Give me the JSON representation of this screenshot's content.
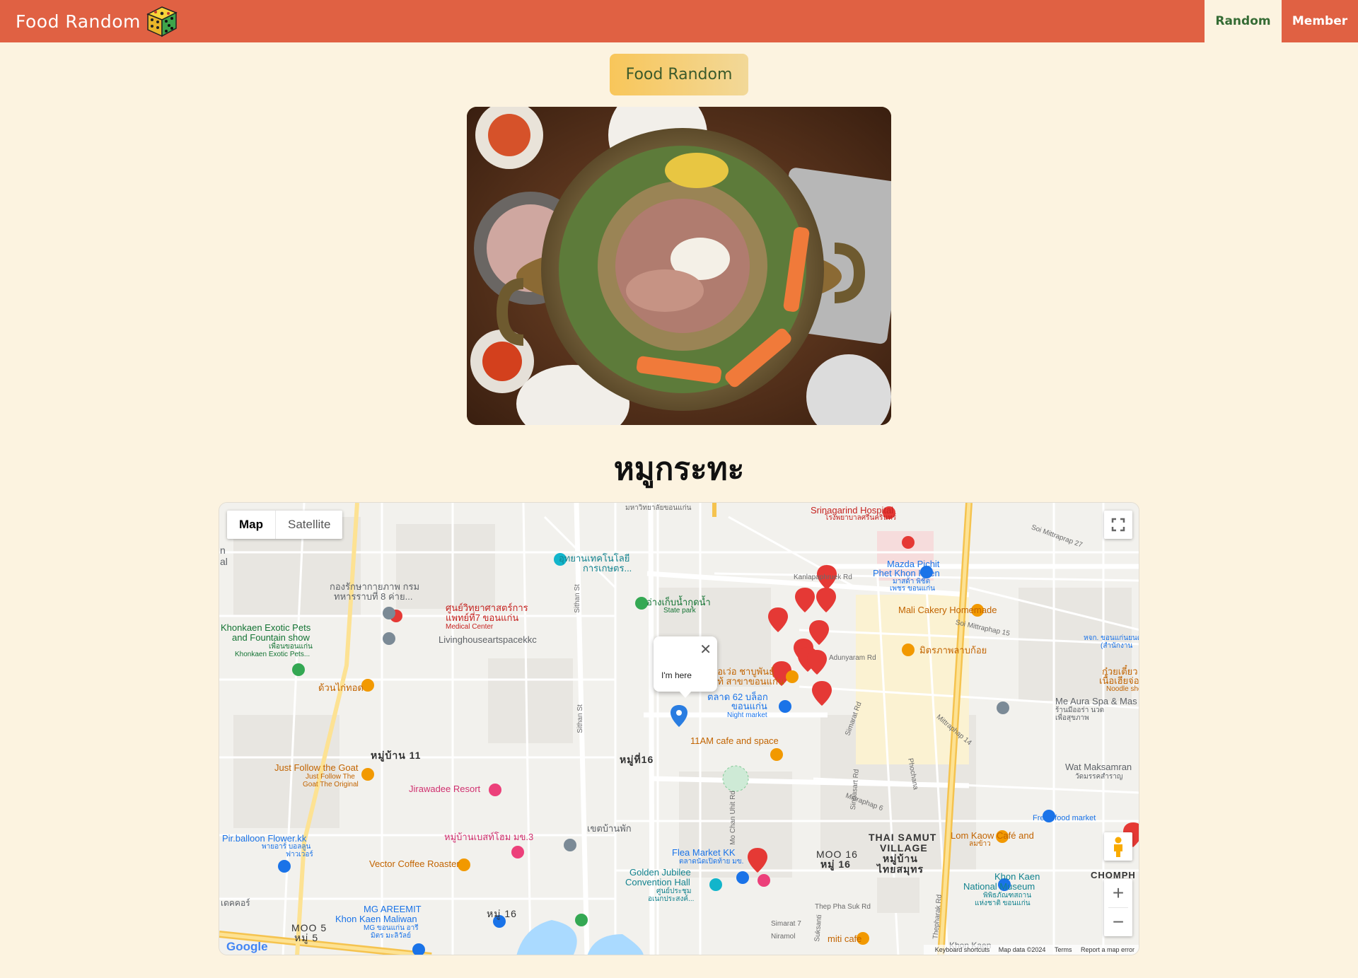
{
  "header": {
    "brand": "Food Random",
    "nav": {
      "random": "Random",
      "member": "Member"
    },
    "colors": {
      "bar": "#e06143",
      "active_bg": "#fcf3e0",
      "active_text": "#356b34"
    }
  },
  "random_button": {
    "label": "Food Random"
  },
  "food": {
    "name": "หมูกระทะ",
    "image_icon": "food-photo-icon"
  },
  "map": {
    "type_control": {
      "map": "Map",
      "satellite": "Satellite",
      "selected": "Map"
    },
    "info_window": {
      "text": "I'm here"
    },
    "zoom": {
      "in": "+",
      "out": "−"
    },
    "footer": {
      "shortcuts": "Keyboard shortcuts",
      "data": "Map data ©2024",
      "terms": "Terms",
      "report": "Report a map error"
    },
    "logo": "Google",
    "labels": {
      "srinagarind": "Srinagarind Hospital",
      "srinagarind_th": "โรงพยาบาลศรีนครินทร์",
      "mahawit": "มหาวิทยาลัยขอนแก่น",
      "utthayan": "อุทยานเทคโนโลยี",
      "utthayan2": "การเกษตร...",
      "mazda": "Mazda Pichit",
      "mazda2": "Phet Khon Kaen",
      "mazda3": "มาสด้า พิชิต",
      "mazda4": "เพชร ขอนแก่น",
      "ang_kep": "อ่างเก็บน้ำกุดน้ำ",
      "ang_kep_en": "State park",
      "mali": "Mali Cakery Homemade",
      "kong": "กองรักษากายภาพ กรม",
      "kong2": "ทหารราบที่ 8 ค่าย...",
      "sunvit": "ศูนย์วิทยาศาสตร์การ",
      "sunvit2": "แพทย์ที่7 ขอนแก่น",
      "sunvit3": "Medical Center",
      "livinghouse": "Livinghouseartspacekkc",
      "exotic": "Khonkaen Exotic Pets",
      "exotic2": "and Fountain show",
      "exotic3": "เพื่อนขอนแก่น",
      "exotic4": "Khonkaen Exotic Pets...",
      "duan": "ด้วนไก่ทอด",
      "bor_wo": "บ้อเว่อ ชาบูพันธุ์",
      "bor_wo2": "แท้ สาขาขอนแก่น",
      "talad": "ตลาด 62 บล็อก",
      "talad2": "ขอนแก่น",
      "talad3": "Night market",
      "mitr": "มิตรภาพลาบก้อย",
      "cafe11": "11AM cafe and space",
      "moo11": "หมู่บ้าน 11",
      "moo16c": "หมู่ที่16",
      "justfollow": "Just Follow the Goat",
      "justfollow2": "Just Follow The",
      "justfollow3": "Goat The Original",
      "jirawadee": "Jirawadee Resort",
      "balloon": "Pir.balloon Flower.kk",
      "balloon2": "พายอาร์ บอลลูน",
      "balloon3": "ฟาวเวอร์",
      "baan_bet": "หมู่บ้านเบสท์โฮม มข.3",
      "vector": "Vector Coffee Roaster",
      "ket": "เขตบ้านพัก",
      "flea": "Flea Market KK",
      "flea2": "ตลาดนัดเปิดท้าย มข.",
      "golden": "Golden Jubilee",
      "golden2": "Convention Hall",
      "golden3": "ศูนย์ประชุม",
      "golden4": "อเนกประสงค์...",
      "mg": "MG AREEMIT",
      "mg2": "Khon Kaen Maliwan",
      "mg3": "MG ขอนแก่น อารี",
      "mg4": "มิตร มะลิวัลย์",
      "moo16b": "หมู่ 16",
      "moo5": "MOO 5",
      "moo5b": "หมู่ 5",
      "thai_samut": "THAI SAMUT",
      "thai_samut2": "VILLAGE",
      "thai_samut3": "หมู่บ้าน",
      "thai_samut4": "ไทยสมุทร",
      "moo16r": "MOO 16",
      "moo16r2": "หมู่ 16",
      "lomkaow": "Lom Kaow Café and",
      "lomkaow2": "ลมข้าว",
      "museum": "Khon Kaen",
      "museum2": "National Museum",
      "museum3": "พิพิธภัณฑสถาน",
      "museum4": "แห่งชาติ ขอนแก่น",
      "miti": "miti cafe",
      "me_aura": "Me Aura Spa & Mas",
      "me_aura2": "ร้านมีออร่า นวด",
      "me_aura3": "เพื่อสุขภาพ",
      "wat": "Wat Maksamran",
      "wat2": "วัดมรรคสำราญ",
      "fresh": "Fresh food market",
      "chomphon": "CHOMPH",
      "kuay": "ก๋วยเตี๋ยว",
      "kuay2": "เนื้อเฮียจ่อย",
      "kuay3": "Noodle shop",
      "hok": "หจก. ขอนแก่นยนต์",
      "hok2": "(สำนักงาน",
      "khon_kaen": "Khon Kaen",
      "kalpaphruk": "Kanlapaphruek Rd",
      "adunyaram": "Adunyaram Rd",
      "mittraphap": "Mittraphap 14",
      "soi_mitr27": "Soi Mittraprap 27",
      "soi_mitr15": "Soi Mittraphap 15",
      "mittraphap6": "Mittraphap 6",
      "thep_pha": "Thep Pha Suk Rd",
      "simarat7": "Simarat 7",
      "niramol": "Niramol",
      "sithan": "Sithan St",
      "sithan2": "Sithan St",
      "mochan": "Mo Chan Uhit Rd",
      "simarat": "Simarat Rd",
      "thepharak": "Thepharak Rd",
      "phochana": "Phochana",
      "sinpasart": "Sinpasart Rd",
      "sukanti": "Suksanti",
      "edge_al": "al",
      "edge_n": "n",
      "edge_dek": "เดคคอร์"
    }
  }
}
